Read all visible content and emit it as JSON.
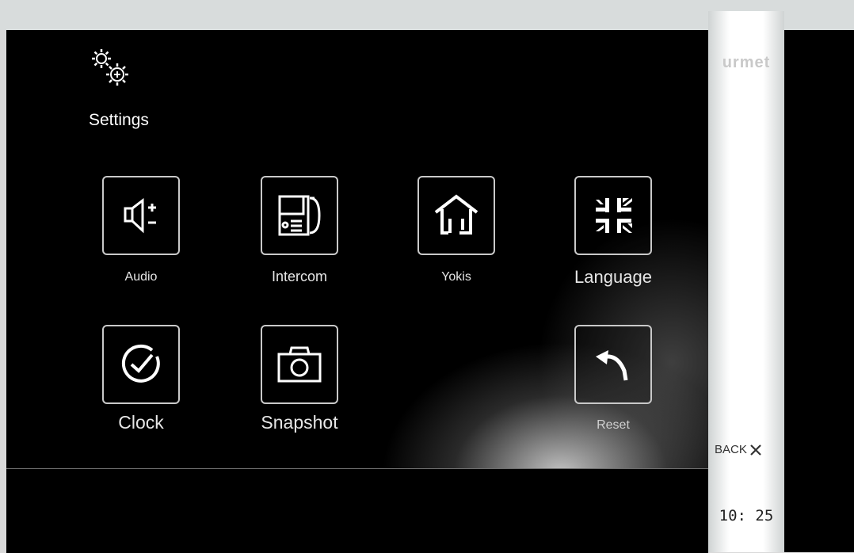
{
  "header": {
    "settings_icon": "gears-icon",
    "title": "Settings"
  },
  "menu": {
    "audio": {
      "label": "Audio",
      "icon": "speaker-volume-icon"
    },
    "intercom": {
      "label": "Intercom",
      "icon": "intercom-handset-icon"
    },
    "yokis": {
      "label": "Yokis",
      "icon": "home-icon"
    },
    "language": {
      "label": "Language",
      "icon": "union-flag-icon"
    },
    "clock": {
      "label": "Clock",
      "icon": "clock-check-icon"
    },
    "snapshot": {
      "label": "Snapshot",
      "icon": "camera-icon"
    },
    "reset": {
      "label": "Reset",
      "icon": "undo-arrow-icon"
    }
  },
  "side": {
    "brand": "urmet",
    "back_label": "BACK",
    "back_icon": "close-x-icon",
    "time": "10: 25"
  },
  "colors": {
    "background": "#000000",
    "tile_border": "#c9c9c9",
    "side_panel": "#ffffff"
  }
}
